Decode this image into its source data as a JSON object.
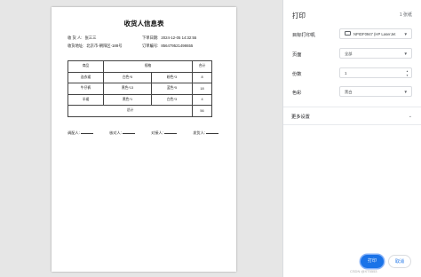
{
  "document": {
    "title": "收货人信息表",
    "receiver_label": "收 货 人:",
    "receiver_value": "张三三",
    "order_time_label": "下单日期:",
    "order_time_value": "2024-12-05 14:32:55",
    "address_label": "收货地址:",
    "address_value": "北京市-朝阳区-188号",
    "order_no_label": "订单编号:",
    "order_no_value": "856479521498655",
    "table_headers": [
      "商品",
      "规格",
      "合计"
    ],
    "rows": [
      {
        "name": "连衣裙",
        "spec1": "白色*5",
        "spec2": "粉色*3",
        "total": "8"
      },
      {
        "name": "牛仔裤",
        "spec1": "黑色*13",
        "spec2": "蓝色*5",
        "total": "18"
      },
      {
        "name": "半裙",
        "spec1": "黑色*1",
        "spec2": "白色*3",
        "total": "4"
      }
    ],
    "sum_label": "总计",
    "sum_value": "56",
    "signs": [
      "调配人:",
      "核对人:",
      "对接人:",
      "发货人:"
    ]
  },
  "panel": {
    "title": "打印",
    "sheet_count": "1 张纸",
    "destination_label": "目标打印机",
    "destination_value": "NPIDF0947 (HP LaserJet",
    "pages_label": "页面",
    "pages_value": "全部",
    "copies_label": "份数",
    "copies_value": "1",
    "color_label": "色彩",
    "color_value": "黑白",
    "more_settings": "更多设置",
    "print_button": "打印",
    "cancel_button": "取消"
  },
  "watermark": "CSDN @XT5553"
}
